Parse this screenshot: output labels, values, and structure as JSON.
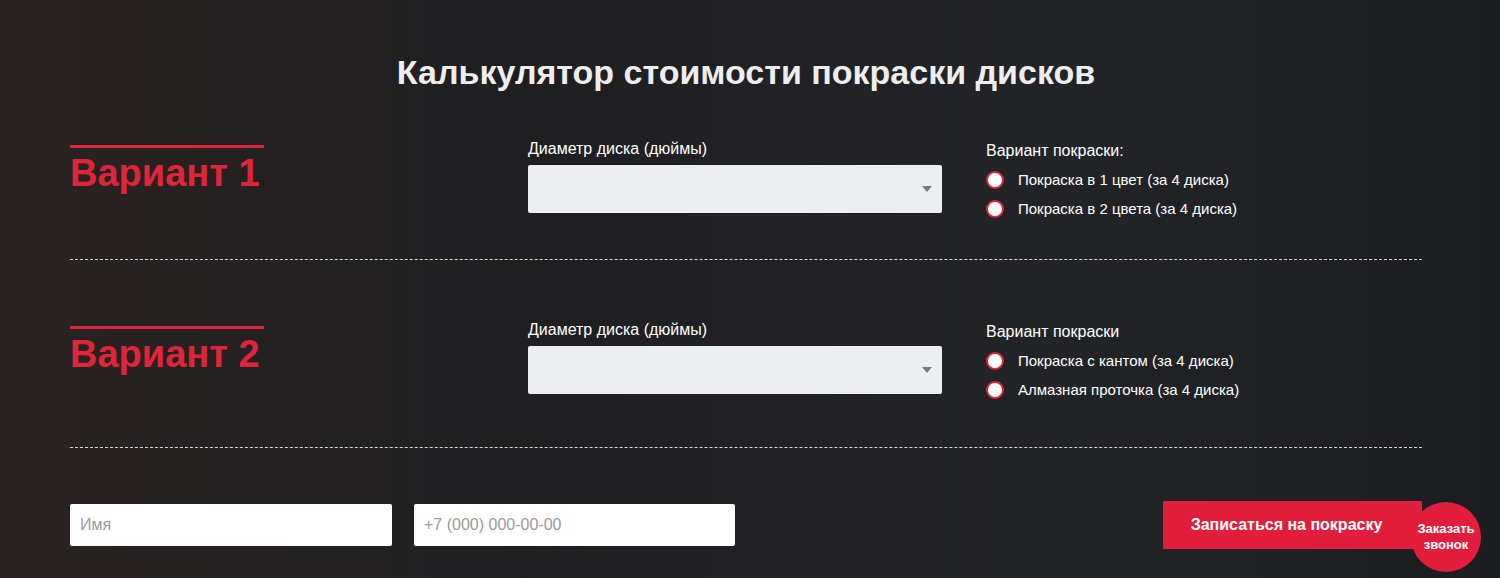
{
  "title": "Калькулятор стоимости покраски дисков",
  "variants": [
    {
      "label": "Вариант 1",
      "diameter_label": "Диаметр диска (дюймы)",
      "options_label": "Вариант покраски:",
      "options": [
        {
          "label": "Покраска в 1 цвет (за 4 диска)",
          "selected": false
        },
        {
          "label": "Покраска в 2 цвета (за 4 диска)",
          "selected": false
        }
      ]
    },
    {
      "label": "Вариант 2",
      "diameter_label": "Диаметр диска (дюймы)",
      "options_label": "Вариант покраски",
      "options": [
        {
          "label": "Покраска с кантом (за 4 диска)",
          "selected": false
        },
        {
          "label": "Алмазная проточка (за 4 диска)",
          "selected": false
        }
      ]
    }
  ],
  "form": {
    "name_placeholder": "Имя",
    "phone_placeholder": "+7 (000) 000-00-00",
    "submit": "Записаться на покраску"
  },
  "callback": {
    "label": "Заказать звонок"
  }
}
